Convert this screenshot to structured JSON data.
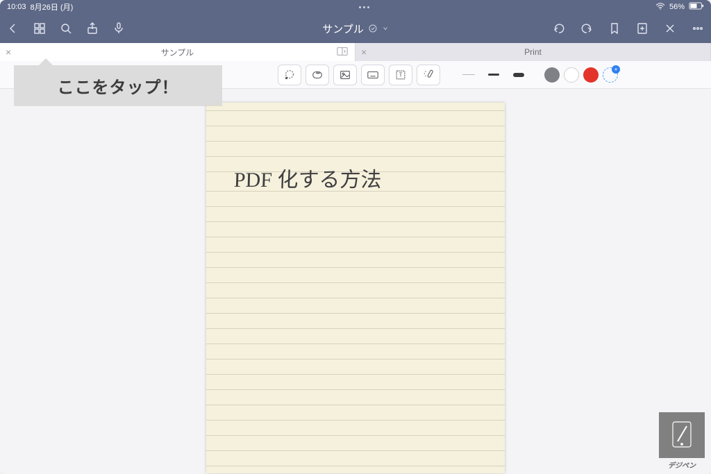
{
  "status": {
    "time": "10:03",
    "date": "8月26日 (月)",
    "battery": "56%"
  },
  "titlebar": {
    "title": "サンプル"
  },
  "tabs": {
    "left": "サンプル",
    "right": "Print"
  },
  "callout": {
    "text": "ここをタップ！"
  },
  "page": {
    "handwriting": "PDF 化する方法"
  },
  "colors": {
    "accent_bar": "#5d6886",
    "paper": "#f6f1dc",
    "red_swatch": "#e3342b",
    "gray_swatch": "#7f8186"
  },
  "watermark": {
    "label": "デジペン"
  }
}
